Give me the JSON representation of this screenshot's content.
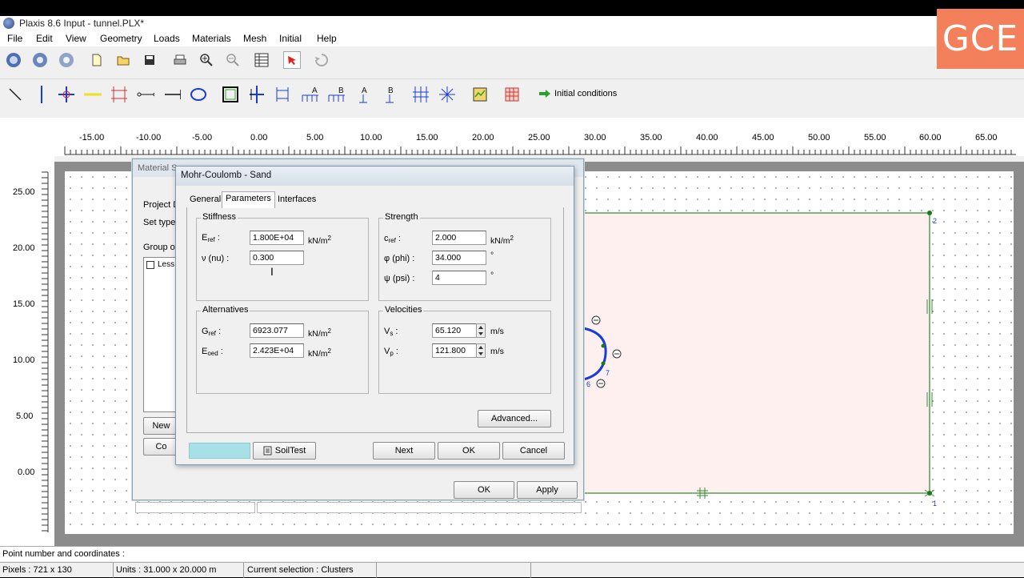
{
  "app": {
    "title": "Plaxis 8.6 Input - tunnel.PLX*",
    "watermark": "GCE"
  },
  "menu": [
    "File",
    "Edit",
    "View",
    "Geometry",
    "Loads",
    "Materials",
    "Mesh",
    "Initial",
    "Help"
  ],
  "toolbar2": {
    "initial_conditions_label": "Initial conditions"
  },
  "ruler": {
    "top": [
      "-15.00",
      "-10.00",
      "-5.00",
      "0.00",
      "5.00",
      "10.00",
      "15.00",
      "20.00",
      "25.00",
      "30.00",
      "35.00",
      "40.00",
      "45.00",
      "50.00",
      "55.00",
      "60.00",
      "65.00"
    ],
    "left": [
      "25.00",
      "20.00",
      "15.00",
      "10.00",
      "5.00",
      "0.00"
    ]
  },
  "geometry": {
    "points": [
      "1",
      "2",
      "6",
      "7"
    ]
  },
  "material_sets": {
    "title": "Material S",
    "project_label": "Project D",
    "set_type_label": "Set type",
    "group_label": "Group or",
    "list_item": "Less",
    "new_label": "New",
    "copy_label": "Co",
    "ok_label": "OK",
    "apply_label": "Apply"
  },
  "dialog": {
    "title": "Mohr-Coulomb - Sand",
    "tabs": [
      "General",
      "Parameters",
      "Interfaces"
    ],
    "stiffness": {
      "title": "Stiffness",
      "e_label": "E",
      "e_sub": "ref",
      "e_value": "1.800E+04",
      "e_unit": "kN/m",
      "nu_label": "ν (nu) :",
      "nu_value": "0.300"
    },
    "strength": {
      "title": "Strength",
      "c_label": "c",
      "c_sub": "ref",
      "c_value": "2.000",
      "c_unit": "kN/m",
      "phi_label": "φ (phi) :",
      "phi_value": "34.000",
      "psi_label": "ψ (psi) :",
      "psi_value": "4",
      "deg": "°"
    },
    "alternatives": {
      "title": "Alternatives",
      "g_label": "G",
      "g_sub": "ref",
      "g_value": "6923.077",
      "eoed_label": "E",
      "eoed_sub": "oed",
      "eoed_value": "2.423E+04",
      "unit": "kN/m"
    },
    "velocities": {
      "title": "Velocities",
      "vs_label": "V",
      "vs_sub": "s",
      "vs_value": "65.120",
      "vp_label": "V",
      "vp_sub": "p",
      "vp_value": "121.800",
      "unit": "m/s"
    },
    "advanced_label": "Advanced...",
    "soiltest_label": "SoilTest",
    "next_label": "Next",
    "ok_label": "OK",
    "cancel_label": "Cancel"
  },
  "status": {
    "point_label": "Point number and coordinates :",
    "pixels": "Pixels : 721 x 130",
    "units": "Units  : 31.000 x 20.000 m",
    "selection": "Current selection : Clusters"
  }
}
